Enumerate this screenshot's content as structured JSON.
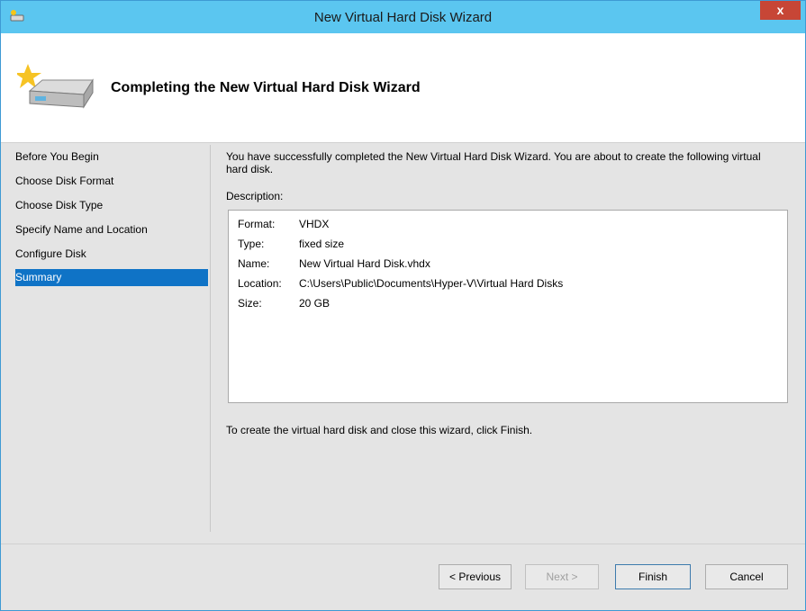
{
  "window": {
    "title": "New Virtual Hard Disk Wizard",
    "close_label": "x"
  },
  "header": {
    "title": "Completing the New Virtual Hard Disk Wizard"
  },
  "nav": {
    "items": [
      {
        "label": "Before You Begin"
      },
      {
        "label": "Choose Disk Format"
      },
      {
        "label": "Choose Disk Type"
      },
      {
        "label": "Specify Name and Location"
      },
      {
        "label": "Configure Disk"
      },
      {
        "label": "Summary"
      }
    ],
    "selected": "Summary"
  },
  "content": {
    "intro": "You have successfully completed the New Virtual Hard Disk Wizard. You are about to create the following virtual hard disk.",
    "description_label": "Description:",
    "rows": [
      {
        "key": "Format:",
        "value": "VHDX"
      },
      {
        "key": "Type:",
        "value": "fixed size"
      },
      {
        "key": "Name:",
        "value": "New Virtual Hard Disk.vhdx"
      },
      {
        "key": "Location:",
        "value": "C:\\Users\\Public\\Documents\\Hyper-V\\Virtual Hard Disks"
      },
      {
        "key": "Size:",
        "value": "20 GB"
      }
    ],
    "finish_note": "To create the virtual hard disk and close this wizard, click Finish."
  },
  "buttons": {
    "previous": "< Previous",
    "next": "Next >",
    "finish": "Finish",
    "cancel": "Cancel"
  },
  "colors": {
    "titlebar": "#5bc6f0",
    "selection": "#0f73c6",
    "close": "#c74636"
  }
}
